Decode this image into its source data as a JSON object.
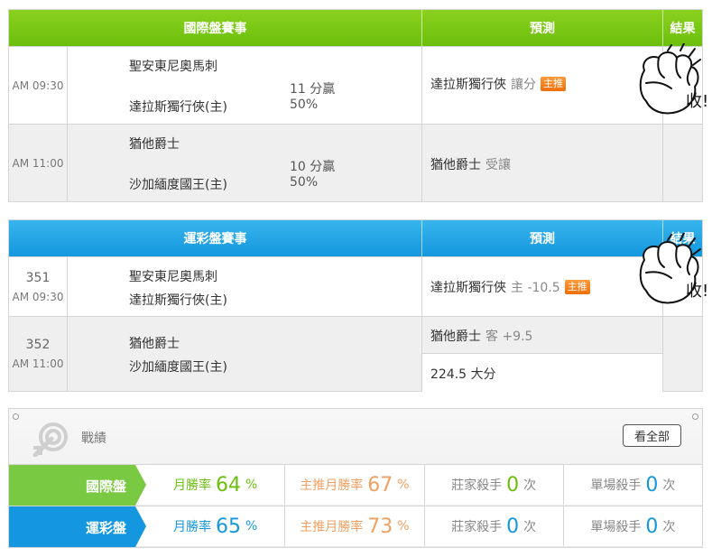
{
  "intl_table": {
    "header": {
      "match": "國際盤賽事",
      "prediction": "預測",
      "result": "結果"
    },
    "rows": [
      {
        "time": "AM 09:30",
        "team_away": "聖安東尼奧馬刺",
        "team_home": "達拉斯獨行俠(主)",
        "odds_main": "11 分贏",
        "odds_pct": "50%",
        "pred_team": "達拉斯獨行俠",
        "pred_tag": "讓分",
        "badge": "主推"
      },
      {
        "time": "AM 11:00",
        "team_away": "猶他爵士",
        "team_home": "沙加緬度國王(主)",
        "odds_main": "10 分贏",
        "odds_pct": "50%",
        "pred_team": "猶他爵士",
        "pred_tag": "受讓"
      }
    ],
    "result_stamp": "收!"
  },
  "lottery_table": {
    "header": {
      "match": "運彩盤賽事",
      "prediction": "預測",
      "result": "結果"
    },
    "rows": [
      {
        "num": "351",
        "time": "AM 09:30",
        "team_away": "聖安東尼奧馬刺",
        "team_home": "達拉斯獨行俠(主)",
        "pred_team": "達拉斯獨行俠",
        "pred_tag": "主 -10.5",
        "badge": "主推"
      },
      {
        "num": "352",
        "time": "AM 11:00",
        "team_away": "猶他爵士",
        "team_home": "沙加緬度國王(主)",
        "pred_team": "猶他爵士",
        "pred_tag": "客 +9.5",
        "pred_extra": "224.5 大分"
      }
    ],
    "result_stamp": "收!"
  },
  "performance": {
    "title": "戰績",
    "see_all": "看全部",
    "rows": [
      {
        "label": "國際盤",
        "color": "#7ac943",
        "monthly_label": "月勝率",
        "monthly_value": "64",
        "main_label": "主推月勝率",
        "main_value": "67",
        "banker_label": "莊家殺手",
        "banker_value": "0",
        "single_label": "單場殺手",
        "single_value": "0",
        "pct": "%",
        "unit": "次"
      },
      {
        "label": "運彩盤",
        "color": "#1497de",
        "monthly_label": "月勝率",
        "monthly_value": "65",
        "main_label": "主推月勝率",
        "main_value": "73",
        "banker_label": "莊家殺手",
        "banker_value": "0",
        "single_label": "單場殺手",
        "single_value": "0",
        "pct": "%",
        "unit": "次"
      }
    ]
  }
}
